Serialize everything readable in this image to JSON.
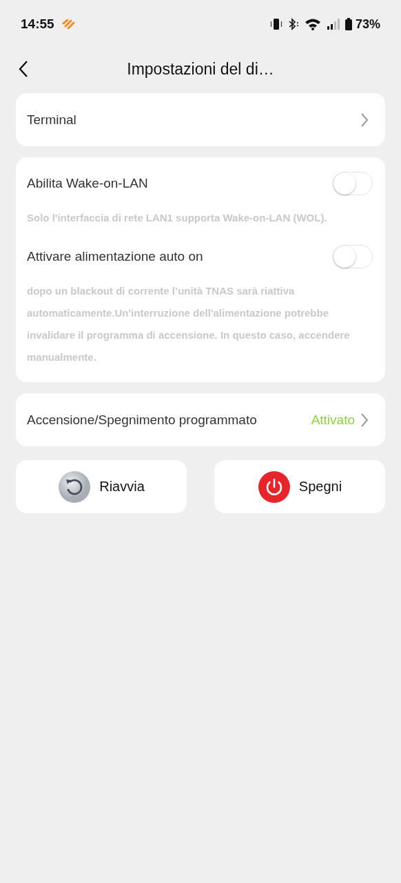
{
  "status_bar": {
    "time": "14:55",
    "battery": "73%"
  },
  "header": {
    "title": "Impostazioni del di…"
  },
  "terminal": {
    "label": "Terminal"
  },
  "toggles": [
    {
      "label": "Abilita Wake-on-LAN",
      "on": false,
      "note": "Solo l'interfaccia di rete LAN1 supporta Wake-on-LAN (WOL)."
    },
    {
      "label": "Attivare alimentazione auto on",
      "on": false,
      "note": "dopo un blackout di corrente l’unità TNAS sarà riattiva automaticamente.Un'interruzione dell'alimentazione potrebbe invalidare il programma di accensione. In questo caso, accendere manualmente."
    }
  ],
  "schedule": {
    "label": "Accensione/Spegnimento programmato",
    "value": "Attivato"
  },
  "actions": [
    {
      "kind": "restart",
      "label": "Riavvia"
    },
    {
      "kind": "power",
      "label": "Spegni"
    }
  ]
}
